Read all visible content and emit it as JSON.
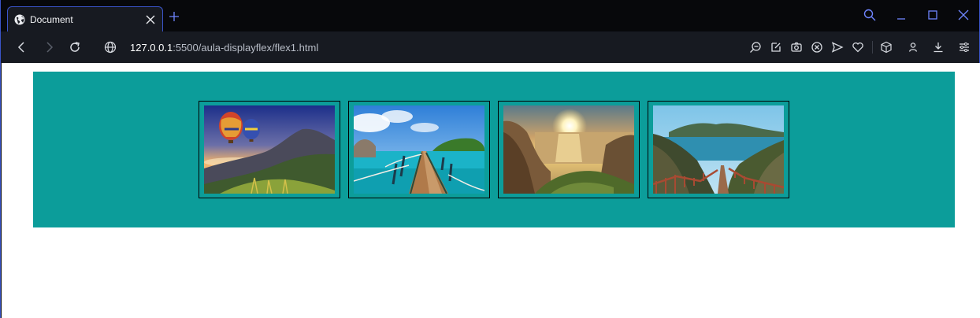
{
  "tab": {
    "title": "Document",
    "favicon": "globe-icon"
  },
  "address_bar": {
    "host": "127.0.0.1",
    "rest": ":5500/aula-displayflex/flex1.html"
  },
  "toolbar_icons": [
    "zoom-out-icon",
    "edit-icon",
    "camera-icon",
    "close-circle-icon",
    "send-icon",
    "heart-icon",
    "cube-icon",
    "profile-icon",
    "download-icon",
    "menu-sliders-icon"
  ],
  "colors": {
    "container": "#0c9d9a",
    "window_accent": "#3a54c8",
    "accent_icon": "#6f85ff"
  },
  "images": [
    {
      "name": "hot-air-balloons-mountain-photo"
    },
    {
      "name": "beach-pier-photo"
    },
    {
      "name": "sunset-cliffs-sea-photo"
    },
    {
      "name": "coastal-stairway-photo"
    }
  ]
}
